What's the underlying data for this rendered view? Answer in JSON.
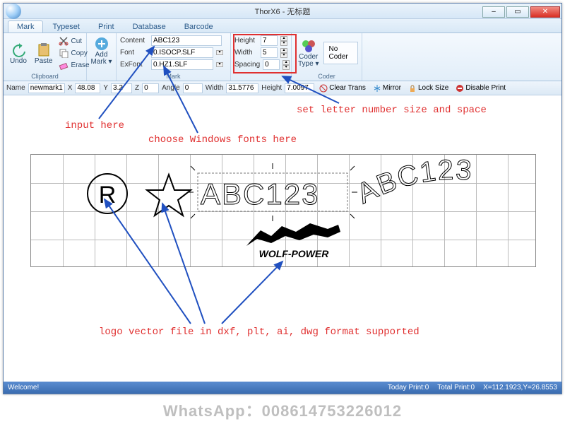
{
  "window": {
    "title": "ThorX6 - 无标题",
    "min": "–",
    "max": "▭",
    "close": "✕"
  },
  "tabs": [
    "Mark",
    "Typeset",
    "Print",
    "Database",
    "Barcode"
  ],
  "active_tab": 0,
  "ribbon": {
    "clipboard": {
      "label": "Clipboard",
      "undo": "Undo",
      "paste": "Paste",
      "cut": "Cut",
      "copy": "Copy",
      "erase": "Erase"
    },
    "addmark": {
      "label": "",
      "add": "Add\nMark ▾"
    },
    "mark": {
      "label": "Mark",
      "content_label": "Content",
      "content_value": "ABC123",
      "font_label": "Font",
      "font_value": "0.ISOCP.SLF",
      "exfont_label": "ExFont",
      "exfont_value": "0.HZ1.SLF",
      "height_label": "Height",
      "height_value": "7",
      "width_label": "Width",
      "width_value": "5",
      "spacing_label": "Spacing",
      "spacing_value": "0"
    },
    "coder": {
      "label": "Coder",
      "codertype": "Coder\nType ▾",
      "nocoder": "No Coder"
    }
  },
  "propbar": {
    "name_label": "Name",
    "name_value": "newmark1",
    "x_label": "X",
    "x_value": "48.08",
    "y_label": "Y",
    "y_value": "3.2",
    "z_label": "Z",
    "z_value": "0",
    "angle_label": "Angle",
    "angle_value": "0",
    "width_label": "Width",
    "width_value": "31.5776",
    "height_label": "Height",
    "height_value": "7.0097",
    "clear_trans": "Clear Trans",
    "mirror": "Mirror",
    "lock_size": "Lock Size",
    "disable_print": "Disable Print"
  },
  "canvas": {
    "text1": "ABC123",
    "text2": "ABC123",
    "logo_text": "WOLF-POWER"
  },
  "statusbar": {
    "welcome": "Welcome!",
    "today": "Today Print:0",
    "total": "Total Print:0",
    "coords": "X=112.1923,Y=26.8553"
  },
  "annotations": {
    "input_here": "input here",
    "choose_fonts": "choose Windows fonts here",
    "letter_size": "set letter number size and space",
    "logo_vector": "logo vector file in dxf, plt, ai, dwg format supported"
  },
  "watermark": "WhatsApp：008614753226012",
  "colors": {
    "annotation": "#e03030",
    "arrow": "#2050c0",
    "ribbon_bg": "#e2eef9"
  }
}
